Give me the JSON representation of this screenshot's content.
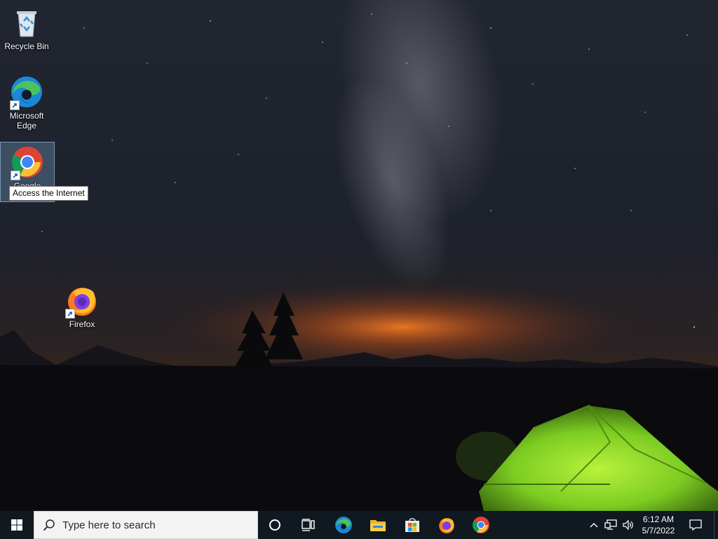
{
  "desktop": {
    "icons": [
      {
        "label": "Recycle Bin",
        "icon": "recycle-bin-icon"
      },
      {
        "label": "Microsoft Edge",
        "icon": "edge-icon"
      },
      {
        "label": "Google Chrome",
        "icon": "chrome-icon",
        "selected": true
      },
      {
        "label": "Firefox",
        "icon": "firefox-icon"
      }
    ],
    "tooltip": "Access the Internet"
  },
  "taskbar": {
    "start": {
      "icon": "windows-logo-icon"
    },
    "search": {
      "placeholder": "Type here to search",
      "icon": "search-icon"
    },
    "cortana": {
      "icon": "cortana-circle-icon"
    },
    "task_view": {
      "icon": "task-view-icon"
    },
    "pinned": [
      {
        "name": "Microsoft Edge",
        "icon": "edge-icon"
      },
      {
        "name": "File Explorer",
        "icon": "folder-icon"
      },
      {
        "name": "Microsoft Store",
        "icon": "store-icon"
      },
      {
        "name": "Firefox",
        "icon": "firefox-icon"
      },
      {
        "name": "Google Chrome",
        "icon": "chrome-icon"
      }
    ],
    "tray": {
      "chevron": "chevron-up-icon",
      "network": "network-icon",
      "volume": "volume-icon",
      "time": "6:12 AM",
      "date": "5/7/2022",
      "notifications": "notification-icon"
    }
  },
  "colors": {
    "taskbar": "#101820",
    "tent": "#8fdc2a",
    "horizon_glow": "#e0661c",
    "sky": "#1a2030"
  }
}
